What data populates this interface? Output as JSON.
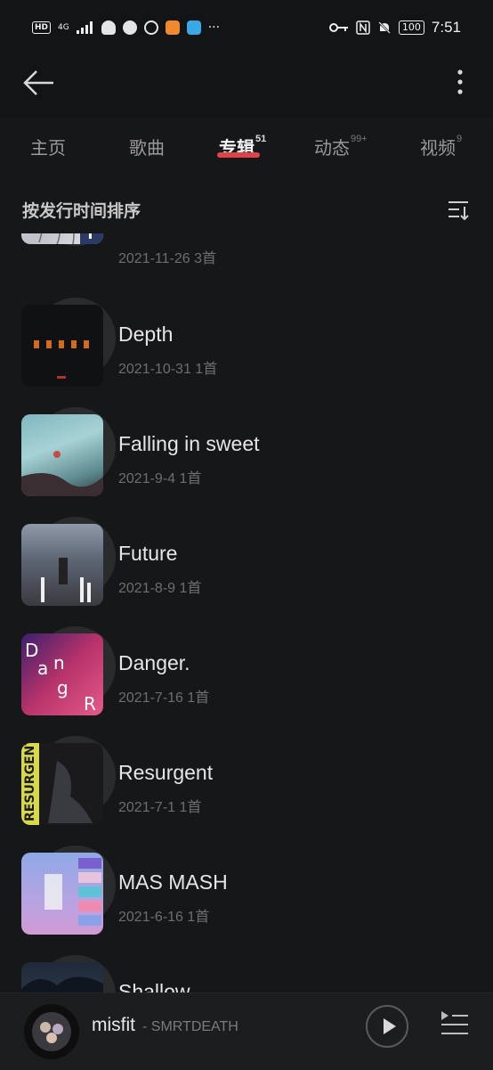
{
  "status_bar": {
    "hd": "HD",
    "network": "4G",
    "dots": "···",
    "battery": "100",
    "time": "7:51"
  },
  "tabs": [
    {
      "label": "主页",
      "count": ""
    },
    {
      "label": "歌曲",
      "count": ""
    },
    {
      "label": "专辑",
      "count": "51"
    },
    {
      "label": "动态",
      "count": "99+"
    },
    {
      "label": "视频",
      "count": "9"
    }
  ],
  "sort": {
    "label": "按发行时间排序"
  },
  "albums": [
    {
      "title": "",
      "meta": "2021-11-26 3首"
    },
    {
      "title": "Depth",
      "meta": "2021-10-31 1首"
    },
    {
      "title": "Falling in sweet",
      "meta": "2021-9-4 1首"
    },
    {
      "title": "Future",
      "meta": "2021-8-9 1首"
    },
    {
      "title": "Danger.",
      "meta": "2021-7-16 1首"
    },
    {
      "title": "Resurgent",
      "meta": "2021-7-1 1首"
    },
    {
      "title": "MAS MASH",
      "meta": "2021-6-16 1首"
    },
    {
      "title": "Shallow",
      "meta": ""
    }
  ],
  "cover_text": {
    "bt": "T",
    "danger_letters": [
      "D",
      "a",
      "n",
      "g",
      "R"
    ],
    "resurgent": "RESURGENT"
  },
  "player": {
    "title": "misfit",
    "artist": "- SMRTDEATH"
  }
}
